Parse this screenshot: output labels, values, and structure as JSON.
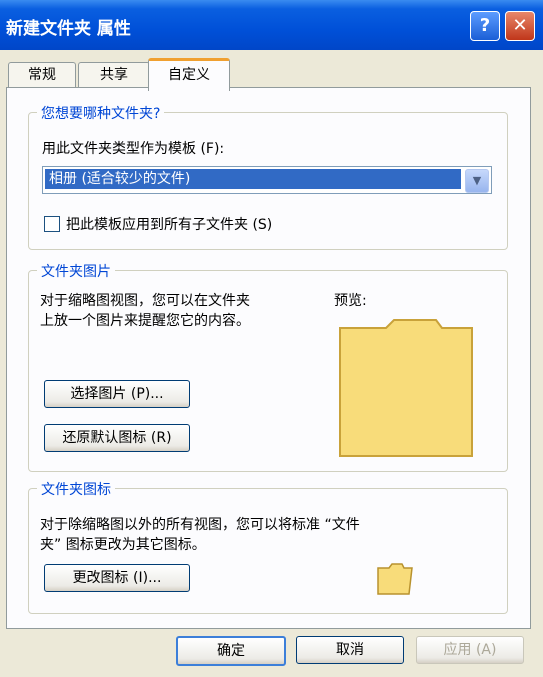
{
  "window": {
    "title": "新建文件夹 属性",
    "help_icon": "?",
    "close_icon": "✕"
  },
  "tabs": [
    {
      "label": "常规"
    },
    {
      "label": "共享"
    },
    {
      "label": "自定义"
    }
  ],
  "group_template": {
    "title": "您想要哪种文件夹?",
    "label": "用此文件夹类型作为模板 (F):",
    "selected": "相册 (适合较少的文件)",
    "apply_sub": "把此模板应用到所有子文件夹 (S)"
  },
  "group_picture": {
    "title": "文件夹图片",
    "desc_line1": "对于缩略图视图，您可以在文件夹",
    "desc_line2": "上放一个图片来提醒您它的内容。",
    "preview_label": "预览:",
    "choose_button": "选择图片 (P)...",
    "restore_button": "还原默认图标 (R)"
  },
  "group_icon": {
    "title": "文件夹图标",
    "desc_line1": "对于除缩略图以外的所有视图，您可以将标准 “文件",
    "desc_line2": "夹” 图标更改为其它图标。",
    "change_button": "更改图标 (I)..."
  },
  "footer": {
    "ok": "确定",
    "cancel": "取消",
    "apply": "应用 (A)"
  },
  "colors": {
    "title_bar": "#0050D8",
    "group_title": "#0046D5",
    "selection": "#316AC5",
    "folder": "#F8DC7A"
  }
}
